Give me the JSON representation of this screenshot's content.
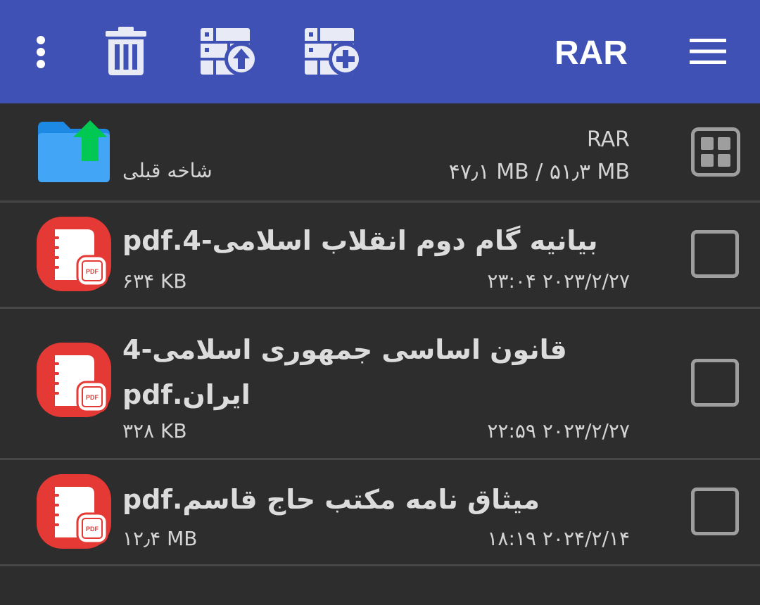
{
  "toolbar": {
    "title": "RAR",
    "color": "#3f51b5",
    "buttons": [
      {
        "name": "more-options",
        "icon": "vertical-dots-icon"
      },
      {
        "name": "delete",
        "icon": "trash-icon"
      },
      {
        "name": "extract-archive",
        "icon": "archive-extract-icon"
      },
      {
        "name": "add-to-archive",
        "icon": "archive-add-icon"
      },
      {
        "name": "menu",
        "icon": "hamburger-menu-icon"
      }
    ]
  },
  "parent": {
    "label": "شاخه قبلی",
    "archive_name": "RAR",
    "size_info": "۴۷٫۱ MB / ۵۱٫۳ MB",
    "icon": "folder-up-icon",
    "view_toggle_icon": "grid-view-icon"
  },
  "files": [
    {
      "name_lines": [
        "بیانیه گام دوم انقلاب اسلامی-4.pdf"
      ],
      "size": "۶۳۴ KB",
      "date": "۲۰۲۳/۲/۲۷ ۲۳:۰۴",
      "icon": "pdf-file-icon",
      "checked": false
    },
    {
      "name_lines": [
        "قانون اساسی جمهوری اسلامی-4",
        "ایران.pdf"
      ],
      "size": "۳۲۸ KB",
      "date": "۲۰۲۳/۲/۲۷ ۲۲:۵۹",
      "icon": "pdf-file-icon",
      "checked": false
    },
    {
      "name_lines": [
        "میثاق نامه مکتب حاج قاسم.pdf"
      ],
      "size": "۱۲٫۴ MB",
      "date": "۲۰۲۴/۲/۱۴ ۱۸:۱۹",
      "icon": "pdf-file-icon",
      "checked": false
    }
  ],
  "pdf_icon_label": "PDF",
  "colors": {
    "background": "#2d2d2d",
    "pdf_red": "#e53935",
    "folder_blue": "#42a5f5",
    "folder_arrow_green": "#00c853",
    "checkbox_border": "#9e9e9e"
  }
}
